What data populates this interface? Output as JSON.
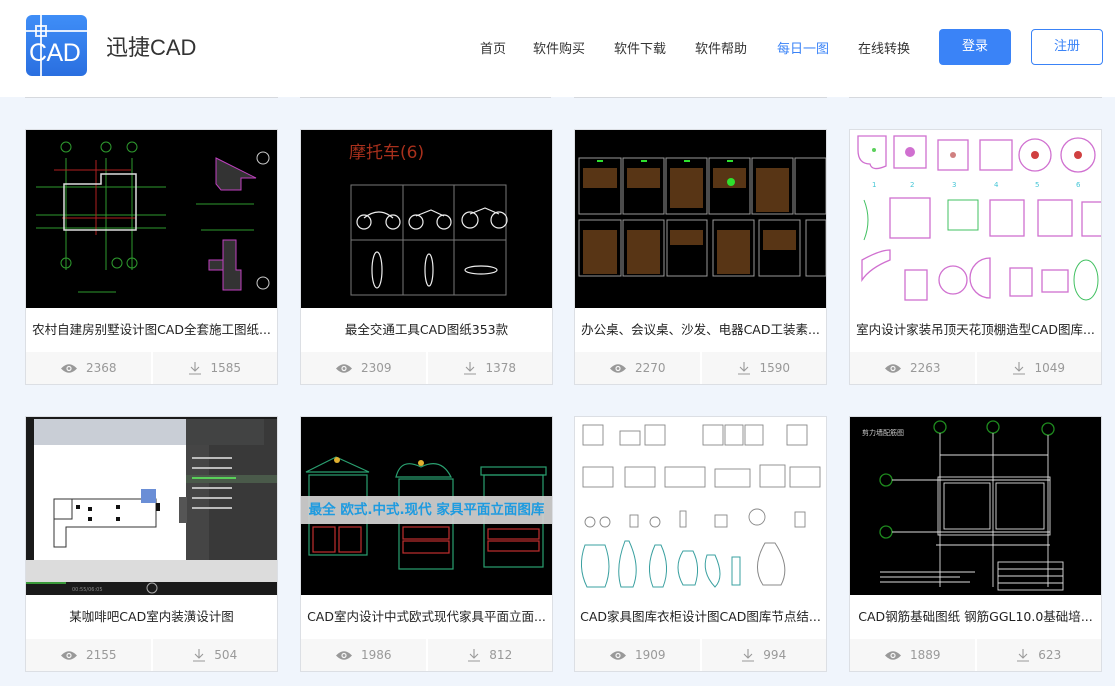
{
  "header": {
    "logo_text": "CAD",
    "brand": "迅捷CAD",
    "nav": [
      {
        "label": "首页",
        "active": false
      },
      {
        "label": "软件购买",
        "active": false
      },
      {
        "label": "软件下载",
        "active": false
      },
      {
        "label": "软件帮助",
        "active": false
      },
      {
        "label": "每日一图",
        "active": true
      },
      {
        "label": "在线转换",
        "active": false
      }
    ],
    "login": "登录",
    "register": "注册"
  },
  "colors": {
    "accent": "#3a83f7",
    "page_bg": "#f0f5fc",
    "stat_text": "#999999"
  },
  "cards": [
    {
      "title": "农村自建房别墅设计图CAD全套施工图纸...",
      "views": "2368",
      "downloads": "1585",
      "thumb": "floorplan-drawing"
    },
    {
      "title": "最全交通工具CAD图纸353款",
      "views": "2309",
      "downloads": "1378",
      "thumb": "motorcycle-drawing",
      "thumb_text": "摩托车(6)"
    },
    {
      "title": "办公桌、会议桌、沙发、电器CAD工装素...",
      "views": "2270",
      "downloads": "1590",
      "thumb": "furniture-sheets"
    },
    {
      "title": "室内设计家装吊顶天花顶棚造型CAD图库...",
      "views": "2263",
      "downloads": "1049",
      "thumb": "ceiling-patterns"
    },
    {
      "title": "某咖啡吧CAD室内装潢设计图",
      "views": "2155",
      "downloads": "504",
      "thumb": "video-player-screenshot",
      "thumb_text": "00:55/06:05"
    },
    {
      "title": "CAD室内设计中式欧式现代家具平面立面...",
      "views": "1986",
      "downloads": "812",
      "thumb": "cabinet-elevations",
      "thumb_text": "最全 欧式.中式.现代 家具平面立面图库"
    },
    {
      "title": "CAD家具图库衣柜设计图CAD图库节点结...",
      "views": "1909",
      "downloads": "994",
      "thumb": "books-vases-drawing"
    },
    {
      "title": "CAD钢筋基础图纸 钢筋GGL10.0基础培...",
      "views": "1889",
      "downloads": "623",
      "thumb": "shear-wall-plan",
      "thumb_text": "剪力墙配筋图"
    }
  ]
}
